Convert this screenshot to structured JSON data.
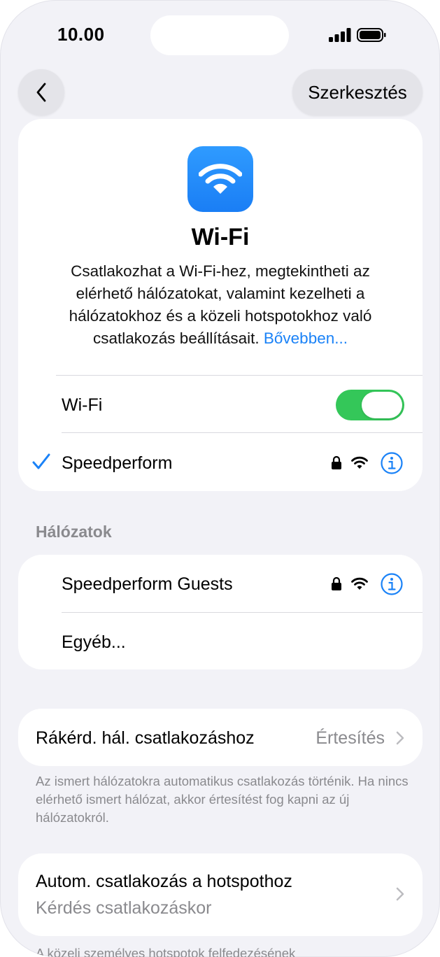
{
  "status": {
    "time": "10.00"
  },
  "nav": {
    "edit_label": "Szerkesztés"
  },
  "hero": {
    "title": "Wi-Fi",
    "description": "Csatlakozhat a Wi-Fi-hez, megtekintheti az elérhető hálózatokat, valamint kezelheti a hálózatokhoz és a közeli hotspotokhoz való csatlakozás beállításait.",
    "link": "Bővebben..."
  },
  "wifi_toggle": {
    "label": "Wi-Fi",
    "state": "on"
  },
  "connected": {
    "name": "Speedperform"
  },
  "networks": {
    "header": "Hálózatok",
    "items": [
      {
        "name": "Speedperform Guests"
      },
      {
        "name": "Egyéb..."
      }
    ]
  },
  "ask_to_join": {
    "label": "Rákérd. hál. csatlakozáshoz",
    "value": "Értesítés",
    "footnote": "Az ismert hálózatokra automatikus csatlakozás történik. Ha nincs elérhető ismert hálózat, akkor értesítést fog kapni az új hálózatokról."
  },
  "auto_hotspot": {
    "label": "Autom. csatlakozás a hotspothoz",
    "value": "Kérdés csatlakozáskor",
    "footnote_partial": "A közeli személyes hotspotok felfedezésének"
  },
  "colors": {
    "accent": "#1a82f7",
    "toggle_on": "#34c759",
    "background": "#f2f2f7"
  }
}
